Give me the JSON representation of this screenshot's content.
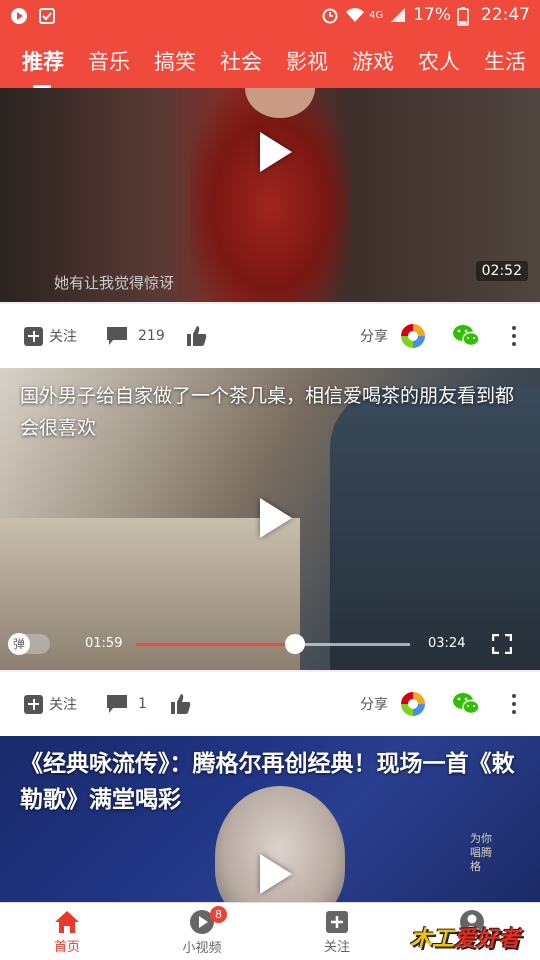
{
  "status_bar": {
    "signal": "4G",
    "battery": "17%",
    "time": "22:47"
  },
  "tabs": [
    {
      "label": "推荐",
      "active": true
    },
    {
      "label": "音乐"
    },
    {
      "label": "搞笑"
    },
    {
      "label": "社会"
    },
    {
      "label": "影视"
    },
    {
      "label": "游戏"
    },
    {
      "label": "农人"
    },
    {
      "label": "生活"
    }
  ],
  "feed": [
    {
      "subtitle": "她有让我觉得惊讶",
      "duration": "02:52",
      "actions": {
        "follow_label": "关注",
        "comment_count": "219",
        "share_label": "分享"
      }
    },
    {
      "title": "国外男子给自家做了一个茶几桌，相信爱喝茶的朋友看到都会很喜欢",
      "danmaku_label": "弹",
      "current_time": "01:59",
      "total_time": "03:24",
      "progress": 0.58,
      "actions": {
        "follow_label": "关注",
        "comment_count": "1",
        "share_label": "分享"
      }
    },
    {
      "title": "《经典咏流传》：腾格尔再创经典！现场一首《敕勒歌》满堂喝彩",
      "watermark": "为你唱腾格"
    }
  ],
  "bottom_nav": [
    {
      "label": "首页",
      "icon": "home-icon",
      "active": true
    },
    {
      "label": "小视频",
      "icon": "play-circle-icon",
      "badge": "8"
    },
    {
      "label": "关注",
      "icon": "plus-square-icon"
    },
    {
      "label": "",
      "icon": "user-icon"
    }
  ],
  "brand_logo": "木工爱好者",
  "colors": {
    "accent": "#f04a3c",
    "wechat": "#2dc100"
  }
}
